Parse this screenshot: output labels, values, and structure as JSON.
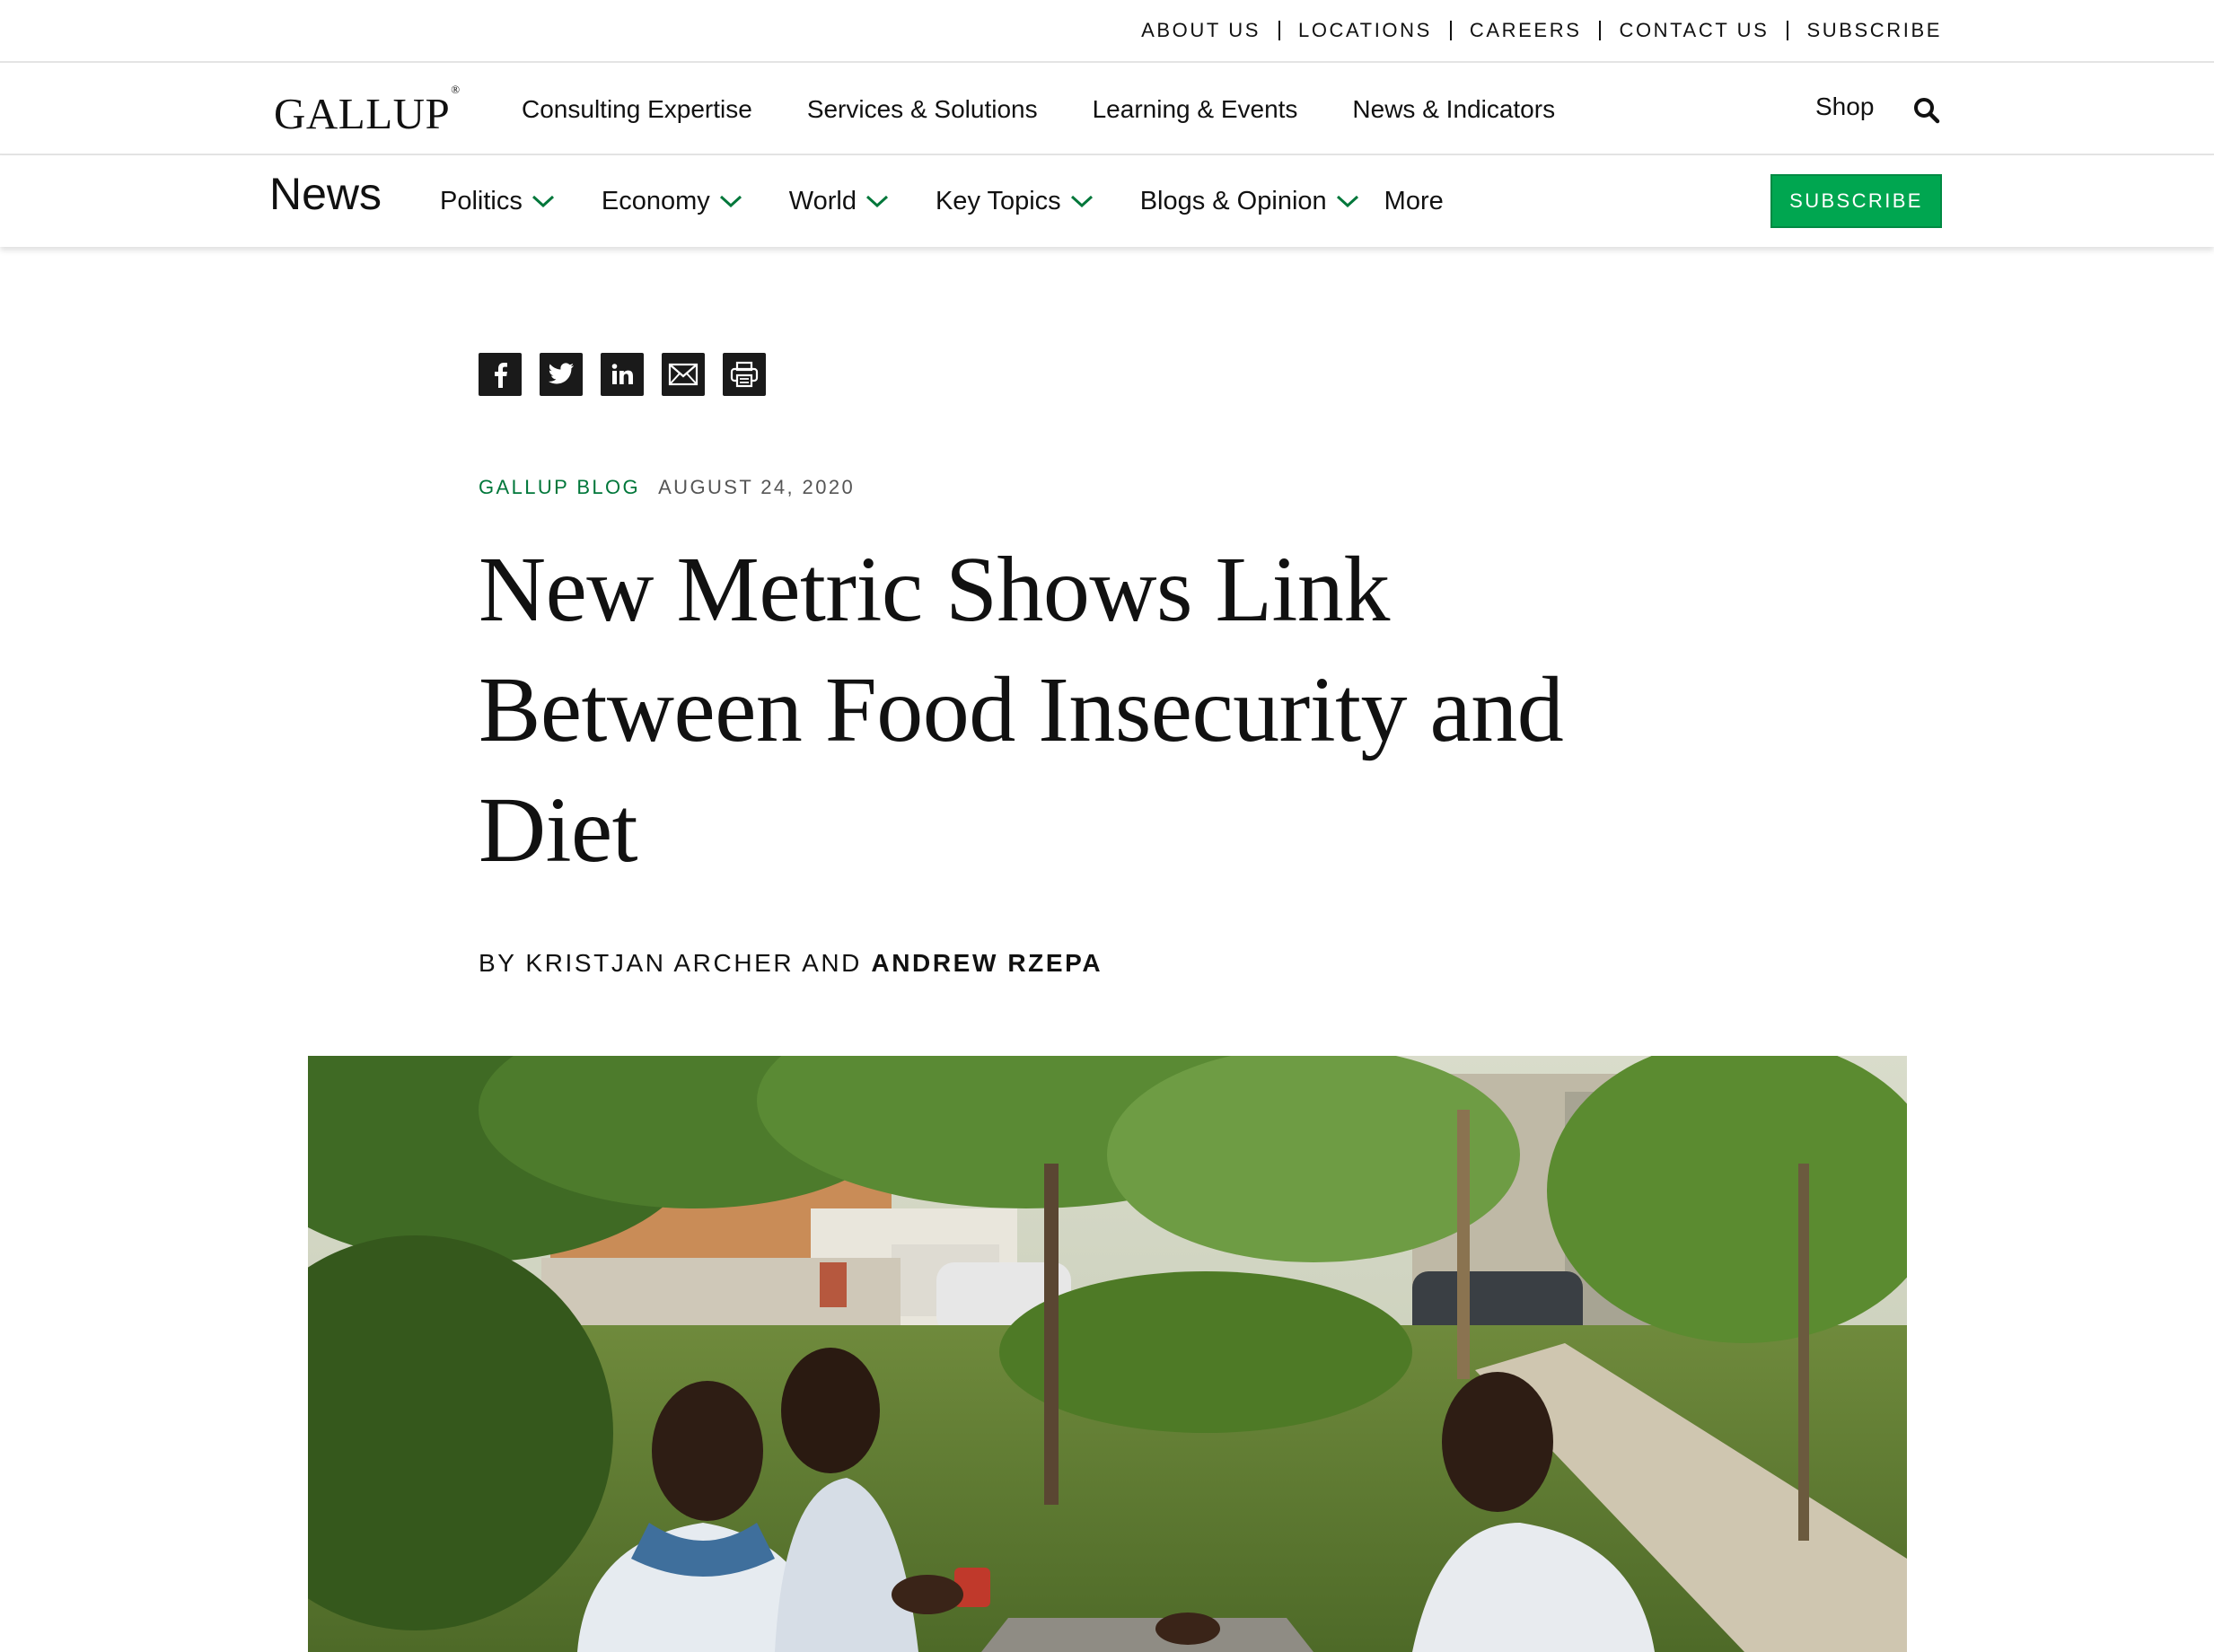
{
  "utility_nav": [
    "ABOUT US",
    "LOCATIONS",
    "CAREERS",
    "CONTACT US",
    "SUBSCRIBE"
  ],
  "logo": "GALLUP",
  "main_nav": {
    "items": [
      "Consulting Expertise",
      "Services & Solutions",
      "Learning & Events",
      "News & Indicators"
    ],
    "shop": "Shop"
  },
  "section_nav": {
    "title": "News",
    "items": [
      "Politics",
      "Economy",
      "World",
      "Key Topics",
      "Blogs & Opinion",
      "More"
    ],
    "subscribe": "SUBSCRIBE"
  },
  "share_icons": [
    "facebook-icon",
    "twitter-icon",
    "linkedin-icon",
    "email-icon",
    "print-icon"
  ],
  "article": {
    "category": "GALLUP BLOG",
    "date": "AUGUST 24, 2020",
    "headline": "New Metric Shows Link Between Food Insecurity and Diet",
    "byline_prefix": "BY KRISTJAN ARCHER AND ",
    "byline_author": "ANDREW RZEPA"
  },
  "colors": {
    "accent_green": "#00a650",
    "category_green": "#00773a",
    "share_icon_bg": "#1a1a1a"
  }
}
